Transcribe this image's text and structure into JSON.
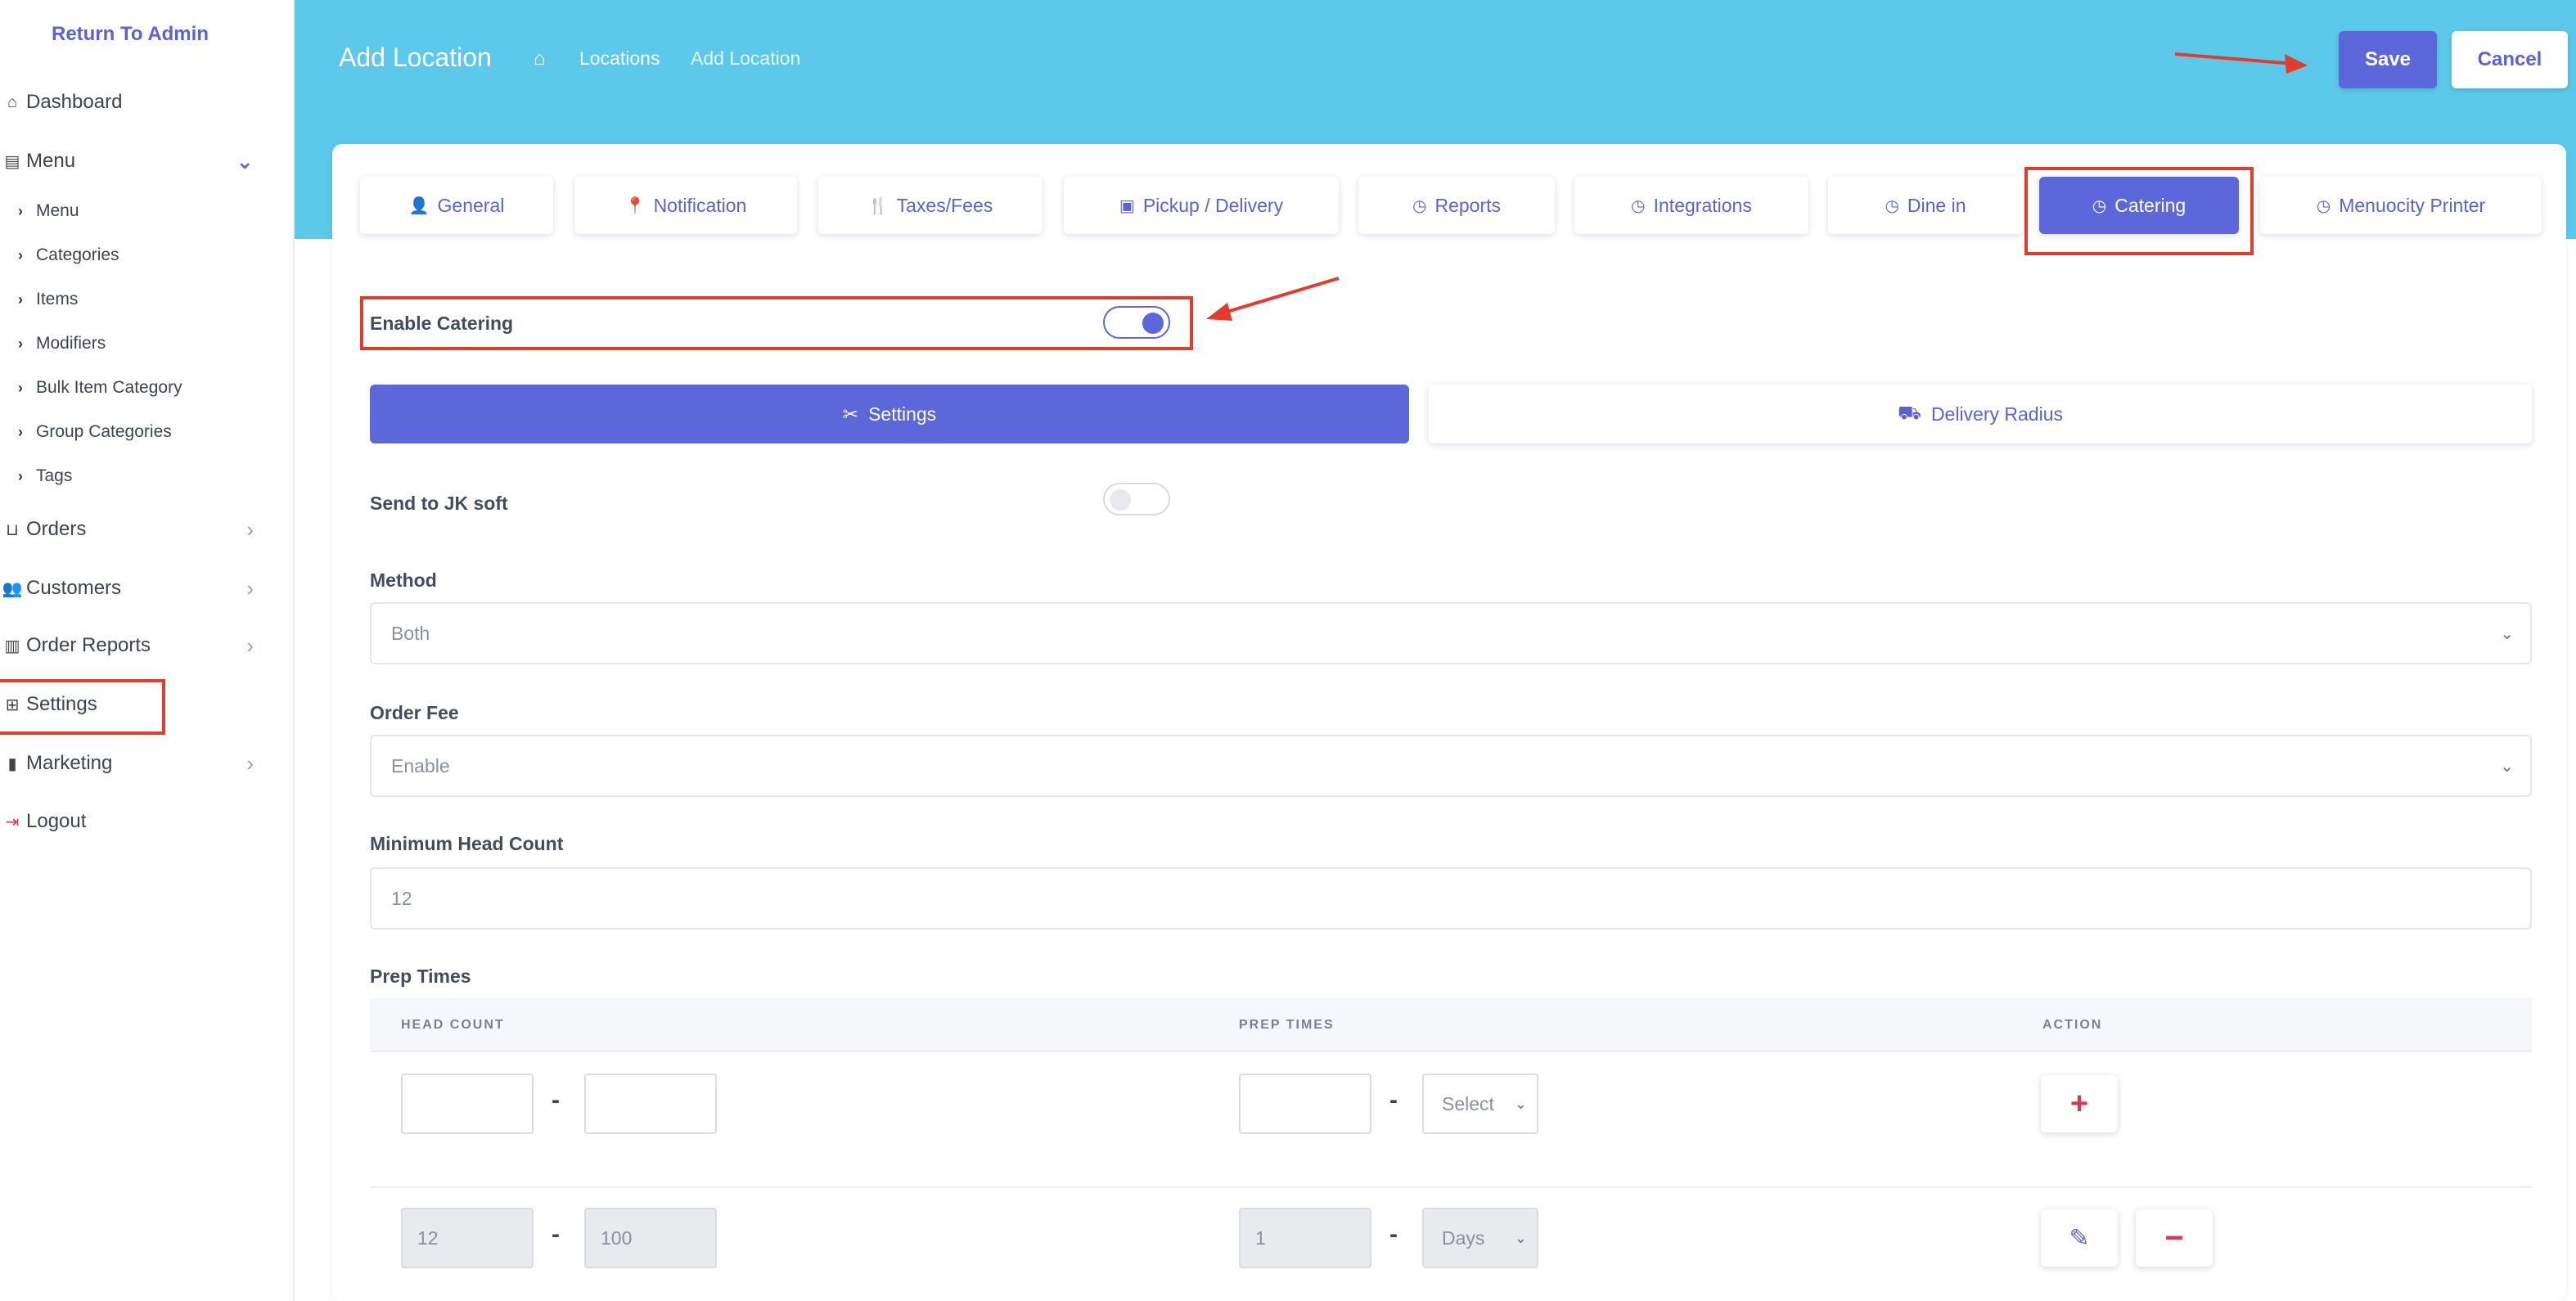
{
  "sidebar": {
    "return_label": "Return To Admin",
    "dashboard": "Dashboard",
    "menu": "Menu",
    "menu_children": [
      "Menu",
      "Categories",
      "Items",
      "Modifiers",
      "Bulk Item Category",
      "Group Categories",
      "Tags"
    ],
    "orders": "Orders",
    "customers": "Customers",
    "order_reports": "Order Reports",
    "settings": "Settings",
    "marketing": "Marketing",
    "logout": "Logout"
  },
  "header": {
    "title": "Add Location",
    "crumb_locations": "Locations",
    "crumb_current": "Add Location",
    "save_label": "Save",
    "cancel_label": "Cancel"
  },
  "tabs": [
    "General",
    "Notification",
    "Taxes/Fees",
    "Pickup / Delivery",
    "Reports",
    "Integrations",
    "Dine in",
    "Catering",
    "Menuocity Printer"
  ],
  "active_tab": "Catering",
  "catering": {
    "enable_label": "Enable Catering",
    "enable_on": true,
    "subtab_settings": "Settings",
    "subtab_delivery": "Delivery Radius",
    "jk_soft_label": "Send to JK soft",
    "jk_soft_on": false,
    "method_label": "Method",
    "method_value": "Both",
    "order_fee_label": "Order Fee",
    "order_fee_value": "Enable",
    "min_head_label": "Minimum Head Count",
    "min_head_value": "12",
    "prep_label": "Prep Times",
    "col_head": "HEAD COUNT",
    "col_prep": "PREP TIMES",
    "col_action": "ACTION",
    "new_row": {
      "head_from": "",
      "head_to": "",
      "prep": "",
      "unit": "Select"
    },
    "rows": [
      {
        "head_from": "12",
        "head_to": "100",
        "prep": "1",
        "unit": "Days"
      }
    ]
  },
  "colors": {
    "accent": "#5c68d9",
    "banner": "#5cc8ea",
    "highlight": "#e33b2c",
    "danger": "#e0364f"
  }
}
